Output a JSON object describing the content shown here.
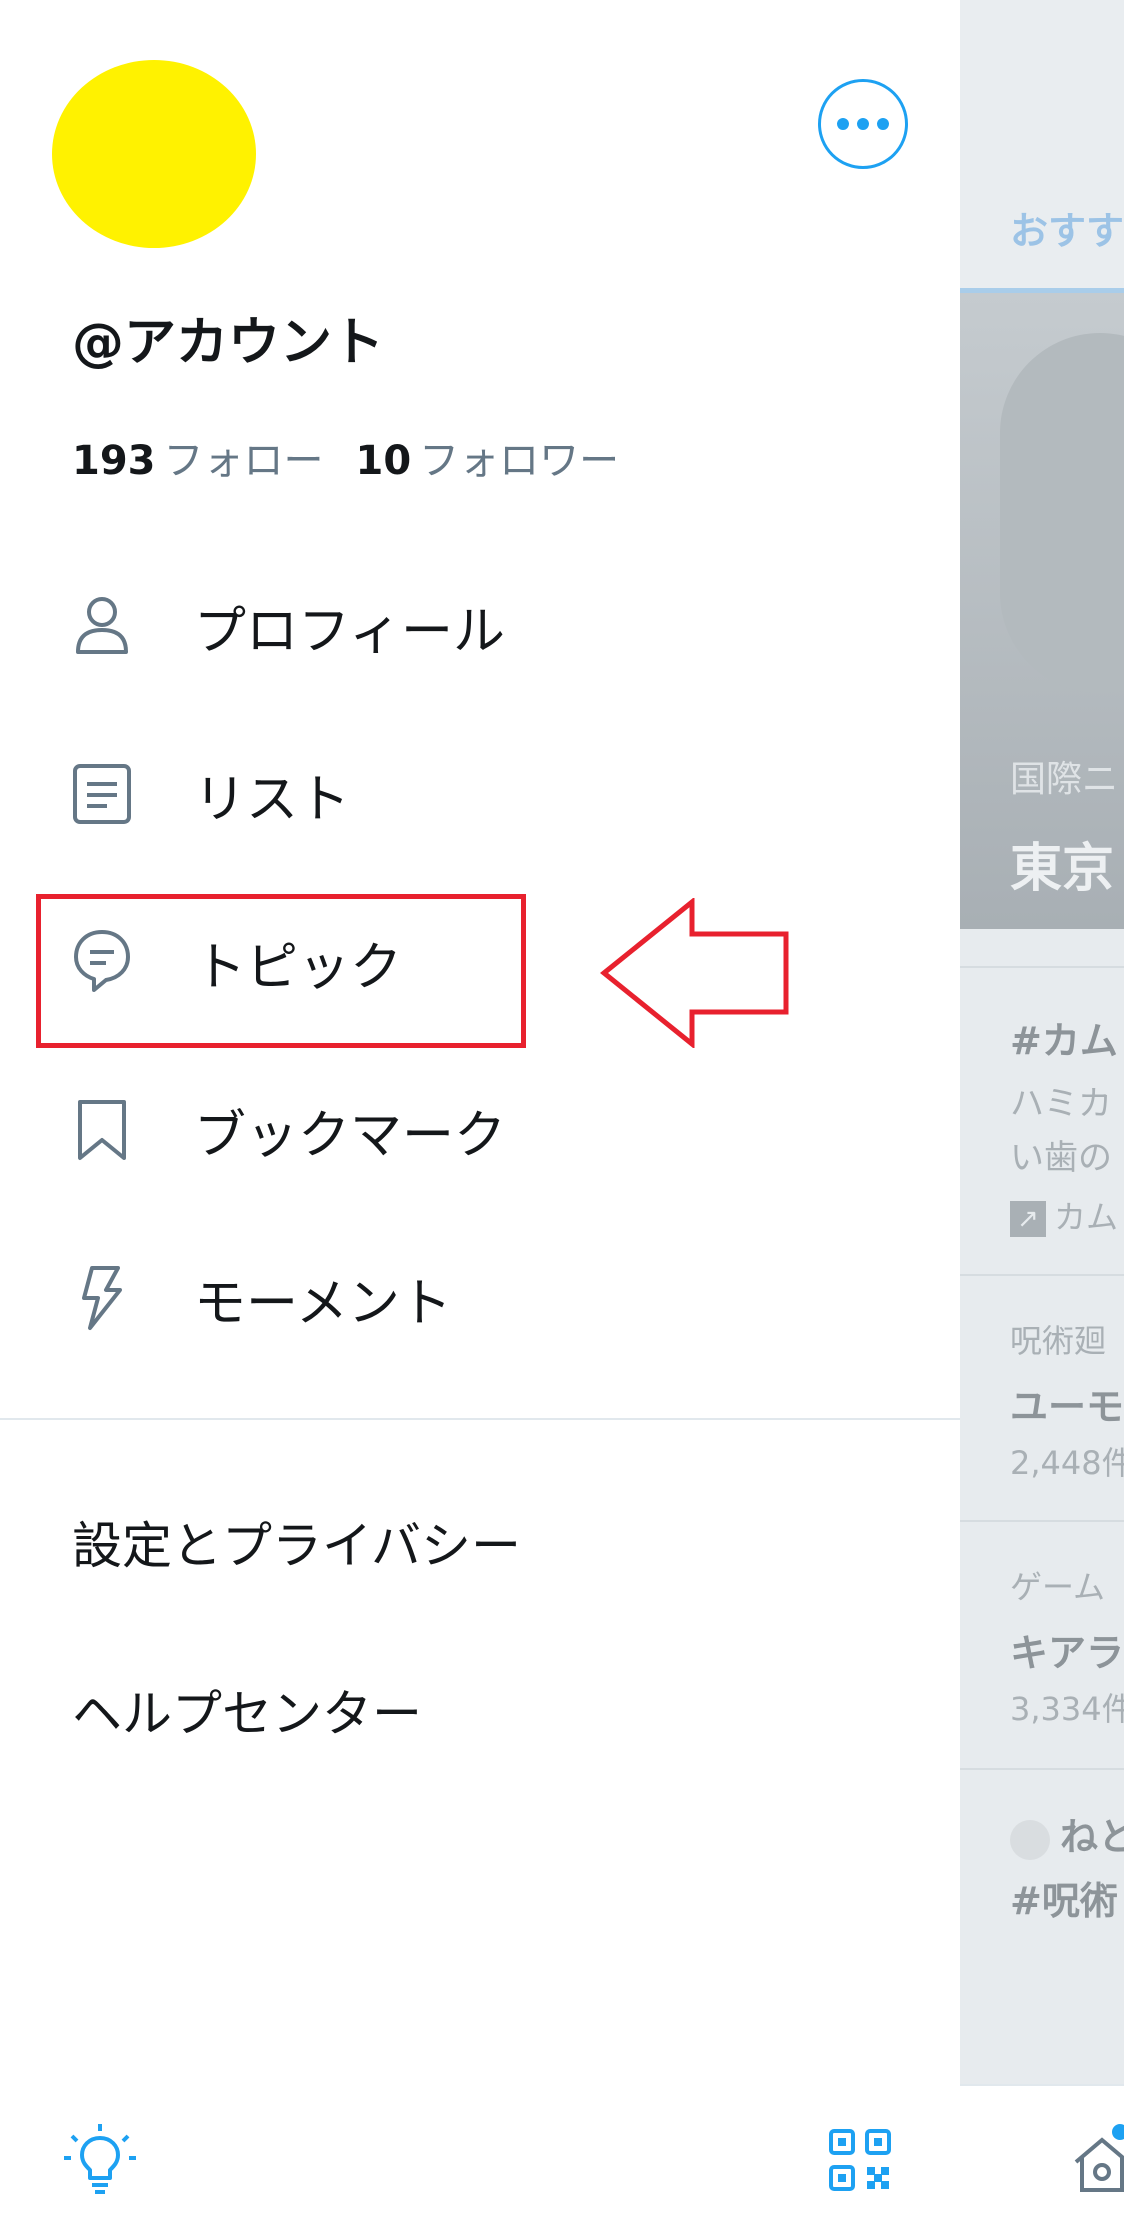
{
  "account": {
    "handle": "@アカウント",
    "following_count": "193",
    "following_label": "フォロー",
    "followers_count": "10",
    "followers_label": "フォロワー"
  },
  "menu": {
    "items": [
      {
        "label": "プロフィール",
        "icon": "person-icon"
      },
      {
        "label": "リスト",
        "icon": "list-icon"
      },
      {
        "label": "トピック",
        "icon": "topic-icon"
      },
      {
        "label": "ブックマーク",
        "icon": "bookmark-icon"
      },
      {
        "label": "モーメント",
        "icon": "lightning-icon"
      }
    ],
    "settings_label": "設定とプライバシー",
    "help_label": "ヘルプセンター"
  },
  "feed": {
    "tab_label": "おすす",
    "hero_category": "国際ニ",
    "hero_title": "東京",
    "trends": [
      {
        "title": "#カム",
        "line1": "ハミカ",
        "line2": "い歯の",
        "link": "カム"
      },
      {
        "category": "呪術廻",
        "title": "ユーモ",
        "count": "2,448件"
      },
      {
        "category": "ゲーム",
        "title": "キアラ",
        "count": "3,334件"
      },
      {
        "user": "ねと",
        "title": "#呪術"
      }
    ]
  },
  "colors": {
    "accent": "#1da1f2",
    "highlight": "#e8212e",
    "avatar": "#fff200",
    "icon_grey": "#657786"
  }
}
